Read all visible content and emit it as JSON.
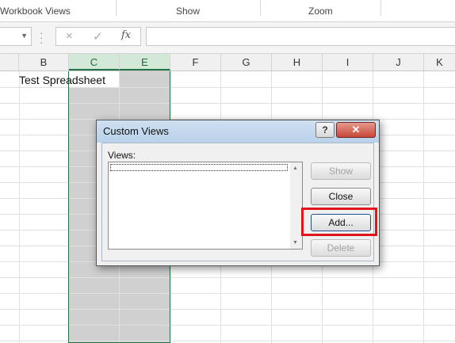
{
  "ribbon": {
    "groups": [
      "Workbook Views",
      "Show",
      "Zoom"
    ]
  },
  "formula_bar": {
    "cancel_icon": "×",
    "enter_icon": "✓",
    "function_label": "fx",
    "value": ""
  },
  "columns": [
    "B",
    "C",
    "E",
    "F",
    "G",
    "H",
    "I",
    "J",
    "K"
  ],
  "cells": {
    "b1": "Test Spreadsheet"
  },
  "dialog": {
    "title": "Custom Views",
    "help_label": "?",
    "close_label": "✕",
    "views_label": "Views:",
    "views": [],
    "buttons": {
      "show": "Show",
      "close": "Close",
      "add": "Add...",
      "delete": "Delete"
    }
  },
  "colors": {
    "selected_column_header": "#d3e8d7",
    "selection_fill": "#d0d0d0",
    "selection_border": "#217346",
    "highlight": "#e0161b"
  }
}
